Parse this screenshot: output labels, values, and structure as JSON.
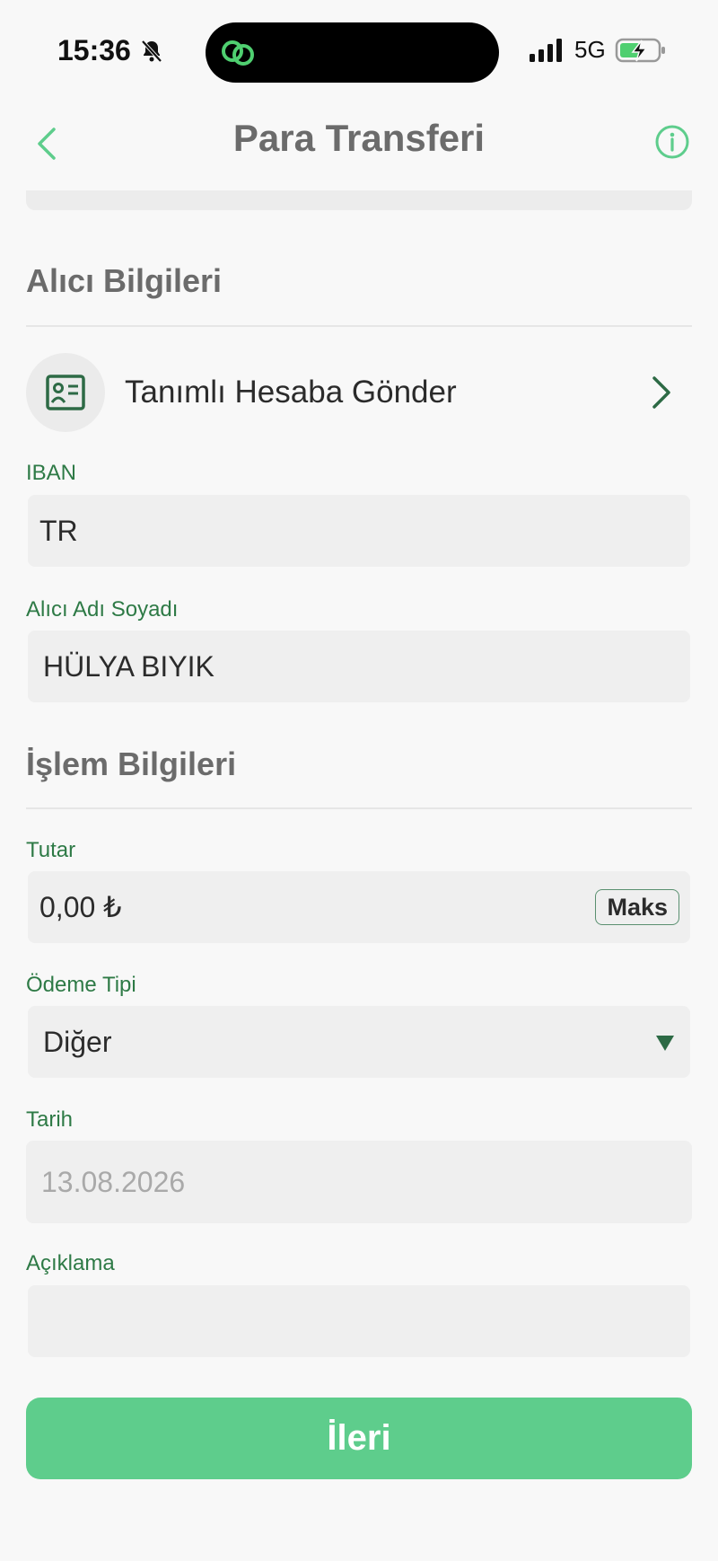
{
  "status_bar": {
    "time": "15:36",
    "network": "5G"
  },
  "header": {
    "title": "Para Transferi"
  },
  "recipient_section": {
    "title": "Alıcı Bilgileri",
    "saved_account_label": "Tanımlı Hesaba Gönder",
    "iban_label": "IBAN",
    "iban_value": "TR",
    "name_label": "Alıcı Adı Soyadı",
    "name_value": "HÜLYA BIYIK"
  },
  "transaction_section": {
    "title": "İşlem Bilgileri",
    "amount_label": "Tutar",
    "amount_value": "0,00 ₺",
    "max_button": "Maks",
    "payment_type_label": "Ödeme Tipi",
    "payment_type_value": "Diğer",
    "date_label": "Tarih",
    "date_value": "13.08.2026",
    "description_label": "Açıklama",
    "description_value": ""
  },
  "actions": {
    "next_button": "İleri"
  },
  "colors": {
    "accent_green": "#5ecd8c",
    "label_green": "#2e7a46",
    "icon_dark_green": "#2d6a45"
  }
}
